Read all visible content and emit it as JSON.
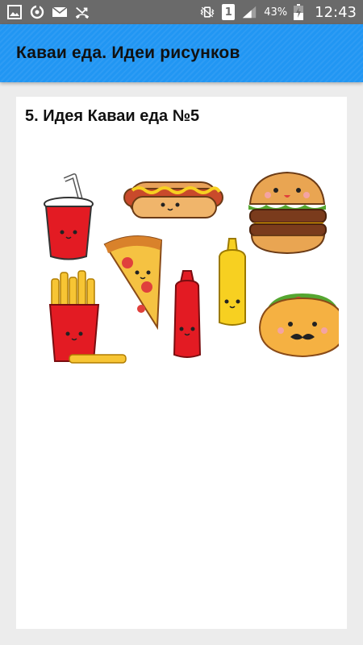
{
  "status_bar": {
    "left_icons": [
      "image-notification-icon",
      "sync-icon",
      "mail-icon",
      "missed-call-icon"
    ],
    "right_icons": [
      "vibrate-icon",
      "sim-1-icon",
      "signal-icon",
      "battery-charging-icon"
    ],
    "sim_label": "1",
    "battery": "43%",
    "time": "12:43"
  },
  "app_bar": {
    "title": "Каваи еда. Идеи рисунков",
    "color": "#2196f3"
  },
  "content": {
    "card_title": "5. Идея Каваи еда №5",
    "image_subject": "kawaii-food-illustration",
    "items": [
      "soda-cup",
      "hot-dog",
      "burger",
      "pizza-slice",
      "mustard-bottle",
      "ketchup-bottle",
      "fries",
      "taco"
    ]
  }
}
